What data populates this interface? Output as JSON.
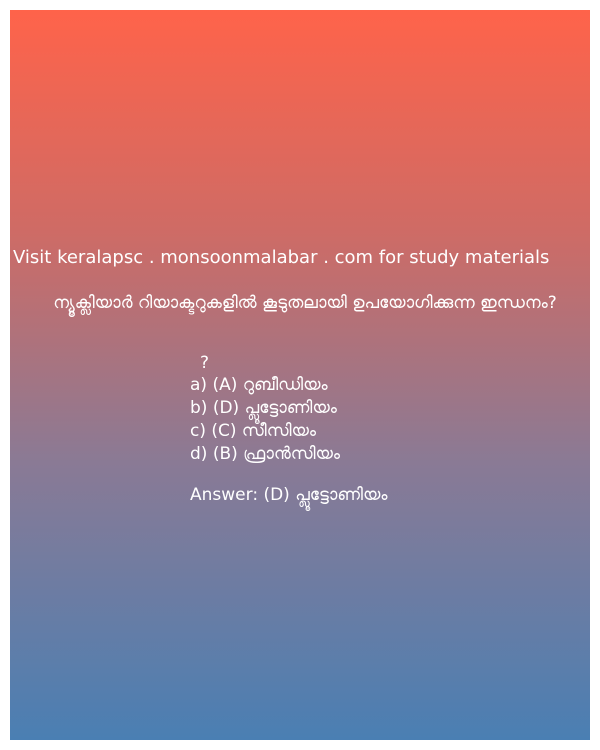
{
  "site_line": "Visit keralapsc . monsoonmalabar . com for study materials",
  "question": "ന്യൂക്ലിയാർ റിയാക്ടറുകളിൽ കൂടുതലായി ഉപയോഗിക്കുന്ന ഇന്ധനം?",
  "question_mark": "?",
  "options": [
    "a) (A) റുബീഡിയം",
    "b)  (D) പ്ലൂട്ടോണിയം",
    "c)  (C) സീസിയം",
    "d)  (B) ഫ്രാൻസിയം"
  ],
  "answer": "Answer:  (D) പ്ലൂട്ടോണിയം",
  "colors": {
    "gradient_top": "#ff634a",
    "gradient_bottom": "#4a7fb3",
    "text": "#ffffff"
  }
}
